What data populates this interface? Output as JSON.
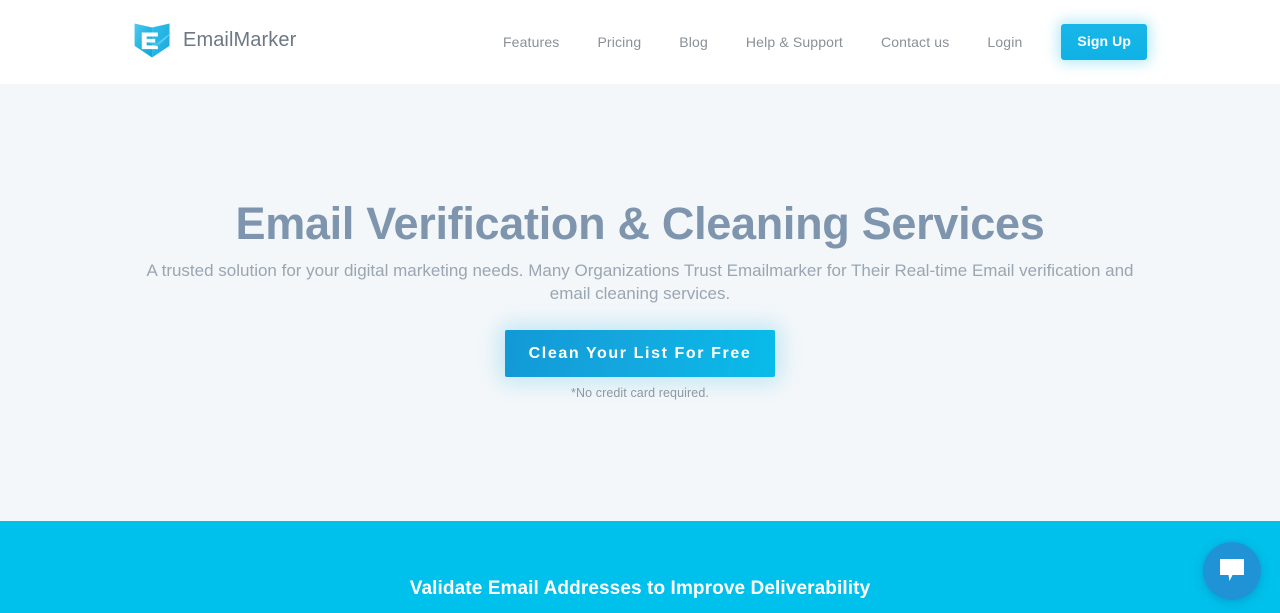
{
  "brand": {
    "name": "EmailMarker",
    "logo_icon": "shield-check-logo-icon",
    "logo_color": "#29b8e5"
  },
  "header": {
    "background": "#ffffff",
    "nav": [
      {
        "label": "Features"
      },
      {
        "label": "Pricing"
      },
      {
        "label": "Blog"
      },
      {
        "label": "Help & Support"
      },
      {
        "label": "Contact us"
      },
      {
        "label": "Login"
      }
    ],
    "signup_label": "Sign Up",
    "signup_color": "#10b3e6"
  },
  "hero": {
    "background": "#f3f7fa",
    "title": "Email Verification & Cleaning Services",
    "title_color": "#7e95ad",
    "subtitle": "A trusted solution for your digital marketing needs. Many Organizations Trust Emailmarker for Their Real-time Email verification and email cleaning services.",
    "cta_label": "Clean Your List For Free",
    "cta_color": "#12a2db",
    "note": "*No credit card required."
  },
  "band": {
    "background": "#00c0ec",
    "title": "Validate Email Addresses to Improve Deliverability"
  },
  "chat": {
    "icon": "chat-bubble-icon",
    "color": "#1f93d6"
  }
}
